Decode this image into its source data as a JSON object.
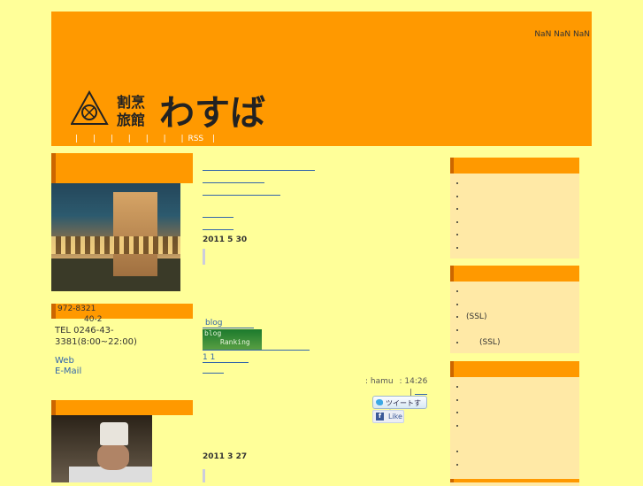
{
  "header": {
    "date": "NaN NaN NaN",
    "logo_text": "わすば",
    "logo_sub": "割烹旅館",
    "nav_items": [
      "",
      "",
      "",
      "",
      "",
      "",
      "",
      "RSS"
    ]
  },
  "left": {
    "address_lines": [
      "972-8321",
      "40-2",
      "TEL 0246-43-3381(8:00~22:00)"
    ],
    "links": [
      "Web",
      "E-Mail"
    ]
  },
  "posts": [
    {
      "date": "2011  5  30"
    },
    {
      "date": "2011  3  27"
    }
  ],
  "blog": {
    "label": "blog",
    "ranking_top": "blog",
    "ranking_bottom": "Ranking",
    "sub_link": "1 1"
  },
  "post_meta": {
    "author": ": hamu",
    "time": ": 14:26",
    "tweet": "ツイートする",
    "like": "Like"
  },
  "sidebar": {
    "box1": [
      "",
      "",
      "",
      "",
      "",
      ""
    ],
    "box2": [
      "",
      "",
      "(SSL)",
      "",
      "(SSL)"
    ],
    "box3": [
      "",
      "",
      "",
      "",
      "",
      "",
      ""
    ]
  },
  "colors": {
    "bg": "#ffff99",
    "header": "#ff9900",
    "accent": "#cc6600"
  }
}
